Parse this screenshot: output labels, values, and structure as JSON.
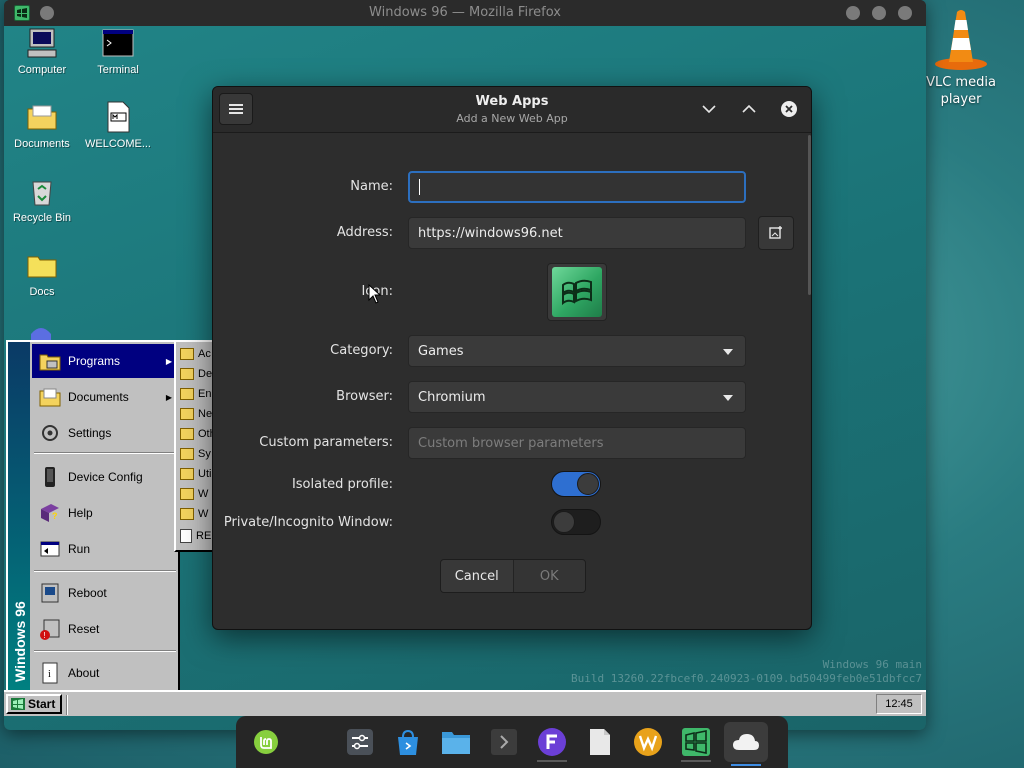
{
  "host": {
    "desktop_icons": [
      {
        "label": "VLC media player",
        "icon": "vlc-cone-icon"
      }
    ],
    "dock": {
      "items": [
        {
          "name": "mint-menu",
          "icon": "linux-mint-icon"
        },
        {
          "name": "settings",
          "icon": "sliders-icon"
        },
        {
          "name": "software-store",
          "icon": "store-bag-icon"
        },
        {
          "name": "files",
          "icon": "folder-icon"
        },
        {
          "name": "terminal",
          "icon": "terminal-icon"
        },
        {
          "name": "fediverse",
          "icon": "f-app-icon"
        },
        {
          "name": "document",
          "icon": "document-icon"
        },
        {
          "name": "w-app",
          "icon": "w-app-icon"
        },
        {
          "name": "windows96",
          "icon": "windows96-icon"
        },
        {
          "name": "cloud",
          "icon": "cloud-icon"
        }
      ]
    }
  },
  "firefox": {
    "title": "Windows 96 — Mozilla Firefox"
  },
  "win96": {
    "desktop_icons": [
      {
        "label": "Computer",
        "icon": "computer-icon"
      },
      {
        "label": "Terminal",
        "icon": "terminal-icon"
      },
      {
        "label": "Documents",
        "icon": "folder-icon"
      },
      {
        "label": "WELCOME...",
        "icon": "markdown-file-icon"
      },
      {
        "label": "Recycle Bin",
        "icon": "recycle-bin-icon"
      },
      {
        "label": "Docs",
        "icon": "folder-icon"
      }
    ],
    "watermark": {
      "line1": "Windows 96 main",
      "line2": "Build 13260.22fbcef0.240923-0109.bd50499feb0e51dbfcc7"
    },
    "taskbar": {
      "start_label": "Start",
      "clock": "12:45"
    },
    "start_menu": {
      "side_label": "Windows 96",
      "items": [
        {
          "label": "Programs",
          "has_submenu": true,
          "active": true
        },
        {
          "label": "Documents",
          "has_submenu": true
        },
        {
          "label": "Settings"
        },
        {
          "label": "Device Config"
        },
        {
          "label": "Help"
        },
        {
          "label": "Run"
        },
        {
          "label": "Reboot"
        },
        {
          "label": "Reset"
        },
        {
          "label": "About"
        }
      ],
      "submenu": [
        "Ac",
        "De",
        "En",
        "Ne",
        "Oth",
        "Sy",
        "Uti",
        "W",
        "W",
        "RE"
      ]
    }
  },
  "dialog": {
    "title": "Web Apps",
    "subtitle": "Add a New Web App",
    "fields": {
      "name": {
        "label": "Name:",
        "value": ""
      },
      "address": {
        "label": "Address:",
        "value": "https://windows96.net"
      },
      "icon": {
        "label": "Icon:"
      },
      "category": {
        "label": "Category:",
        "value": "Games"
      },
      "browser": {
        "label": "Browser:",
        "value": "Chromium"
      },
      "custom_parameters": {
        "label": "Custom parameters:",
        "placeholder": "Custom browser parameters"
      },
      "isolated_profile": {
        "label": "Isolated profile:",
        "checked": true
      },
      "private_window": {
        "label": "Private/Incognito Window:",
        "checked": false
      }
    },
    "buttons": {
      "cancel": "Cancel",
      "ok": "OK"
    },
    "colors": {
      "accent": "#2e6fd1",
      "background": "#2d2d2d"
    }
  }
}
